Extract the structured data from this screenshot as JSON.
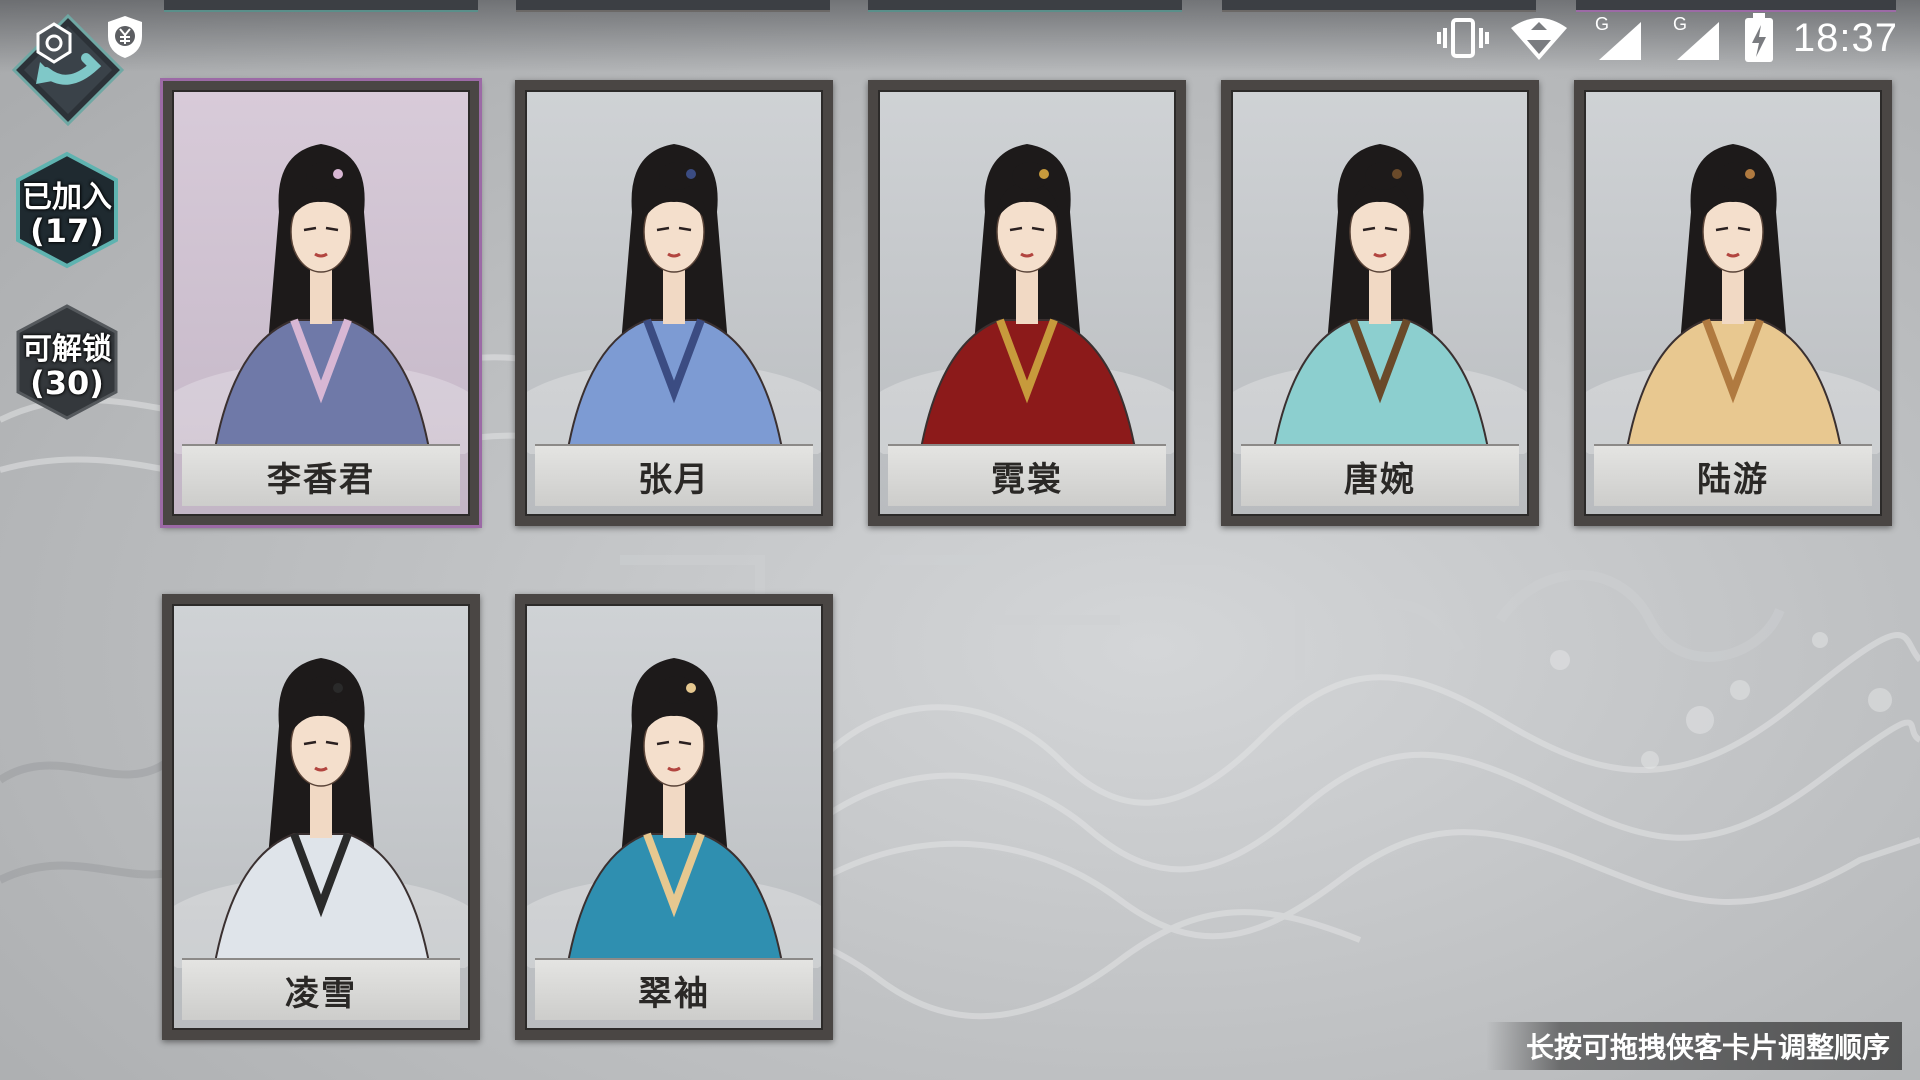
{
  "status_bar": {
    "time": "18:37",
    "network_labels": [
      "G",
      "G"
    ],
    "icons": [
      "vibrate-icon",
      "wifi-icon",
      "signal-icon",
      "signal-icon",
      "battery-charging-icon"
    ]
  },
  "header": {
    "back_icon": "back-arrow-icon",
    "shield_icon": "yen-shield-icon"
  },
  "sidebar": {
    "joined": {
      "label": "已加入",
      "count": "(17)"
    },
    "unlockable": {
      "label": "可解锁",
      "count": "(30)"
    }
  },
  "cards": [
    {
      "name": "李香君",
      "selected": true,
      "robe_color": "#6f79a8",
      "accent": "#d8b7d4"
    },
    {
      "name": "张月",
      "selected": false,
      "robe_color": "#7d9bd3",
      "accent": "#3b4c82"
    },
    {
      "name": "霓裳",
      "selected": false,
      "robe_color": "#8c1a1a",
      "accent": "#c79a3c"
    },
    {
      "name": "唐婉",
      "selected": false,
      "robe_color": "#8ccfcf",
      "accent": "#6a4a2a"
    },
    {
      "name": "陆游",
      "selected": false,
      "robe_color": "#e8c890",
      "accent": "#b07a40"
    },
    {
      "name": "凌雪",
      "selected": false,
      "robe_color": "#dfe4ea",
      "accent": "#2a2a2a"
    },
    {
      "name": "翠袖",
      "selected": false,
      "robe_color": "#2f8fb0",
      "accent": "#e6c890"
    }
  ],
  "hint": "长按可拖拽侠客卡片调整顺序",
  "colors": {
    "selected_border": "#9c6aa6",
    "card_frame": "#4a4644",
    "nameplate": "#dcdcda"
  }
}
